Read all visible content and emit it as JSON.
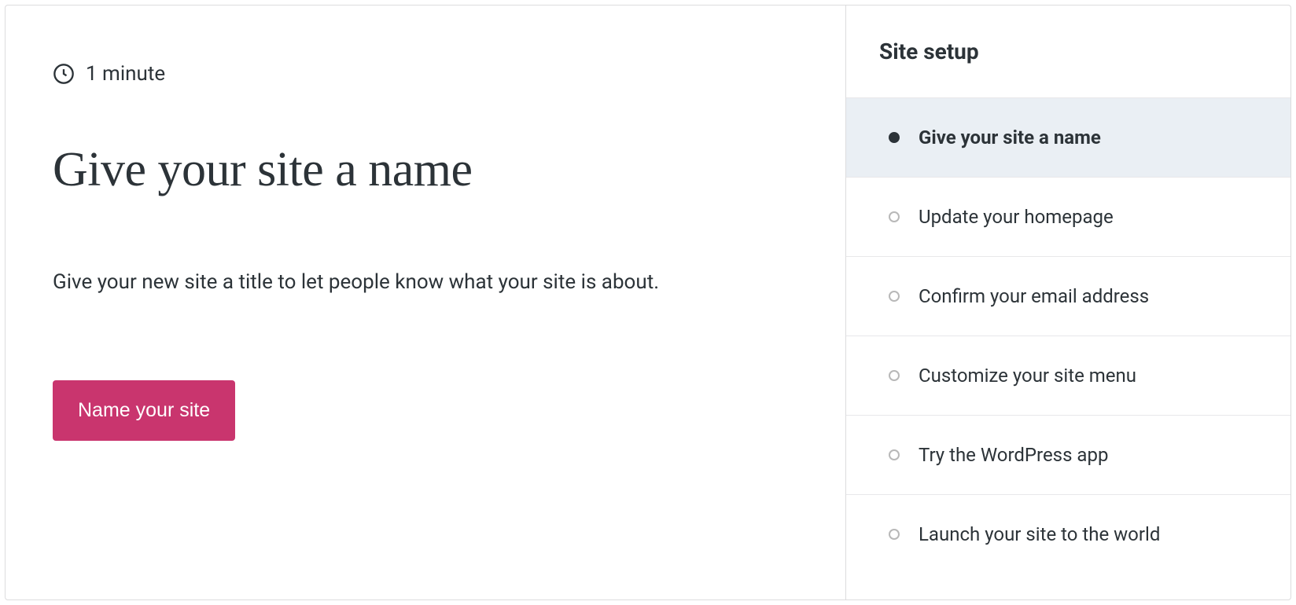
{
  "main": {
    "time_estimate": "1 minute",
    "title": "Give your site a name",
    "description": "Give your new site a title to let people know what your site is about.",
    "button_label": "Name your site"
  },
  "sidebar": {
    "title": "Site setup",
    "steps": [
      {
        "label": "Give your site a name",
        "active": true
      },
      {
        "label": "Update your homepage",
        "active": false
      },
      {
        "label": "Confirm your email address",
        "active": false
      },
      {
        "label": "Customize your site menu",
        "active": false
      },
      {
        "label": "Try the WordPress app",
        "active": false
      },
      {
        "label": "Launch your site to the world",
        "active": false
      }
    ]
  }
}
